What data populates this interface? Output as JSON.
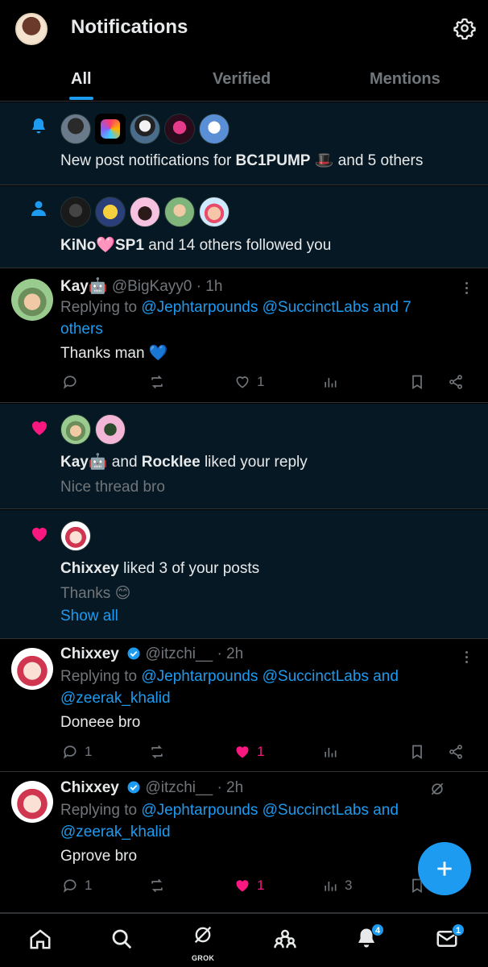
{
  "header": {
    "title": "Notifications",
    "avatar": "profile-avatar",
    "settings_icon": "gear-icon"
  },
  "tabs": [
    {
      "label": "All",
      "active": true
    },
    {
      "label": "Verified"
    },
    {
      "label": "Mentions"
    }
  ],
  "notifications": [
    {
      "type": "new-post",
      "icon": "bell-icon",
      "text_prefix": "New post notifications for ",
      "text_bold": "BC1PUMP",
      "emoji": "🎩",
      "text_suffix": " and 5 others"
    },
    {
      "type": "follow",
      "icon": "person-icon",
      "name": "KiNo",
      "emoji": "🩷",
      "name2": "SP1",
      "text_suffix": " and 14 others followed you"
    },
    {
      "type": "reply",
      "author": "Kay",
      "author_emoji": "🤖",
      "handle": "@BigKayy0",
      "time": "· 1h",
      "replying_prefix": "Replying to ",
      "replying_to": "@Jephtarpounds @SuccinctLabs and 7",
      "replying_to_2": "others",
      "body": "Thanks man",
      "body_emoji": "💙",
      "likes": "1"
    },
    {
      "type": "like",
      "icon": "heart-icon",
      "name1": "Kay",
      "name1_emoji": "🤖",
      "joiner": " and ",
      "name2": "Rocklee",
      "text_suffix": " liked your reply",
      "snippet": "Nice thread bro"
    },
    {
      "type": "like-multi",
      "icon": "heart-icon",
      "name": "Chixxey",
      "text_suffix": " liked 3 of your posts",
      "snippet": "Thanks",
      "snippet_emoji": "😊",
      "show_all": "Show all"
    },
    {
      "type": "reply",
      "author": "Chixxey",
      "handle": "@itzchi__",
      "time": "· 2h",
      "replying_prefix": "Replying to ",
      "replying_to": "@Jephtarpounds @SuccinctLabs and",
      "replying_to_2": "@zeerak_khalid",
      "body": "Doneee bro",
      "replies": "1",
      "likes": "1"
    },
    {
      "type": "reply",
      "author": "Chixxey",
      "handle": "@itzchi__",
      "time": "· 2h",
      "replying_prefix": "Replying to ",
      "replying_to": "@Jephtarpounds @SuccinctLabs and",
      "replying_to_2": "@zeerak_khalid",
      "body": "Gprove bro",
      "replies": "1",
      "likes": "1",
      "views": "3"
    }
  ],
  "bottom_nav": {
    "items": [
      "home-icon",
      "search-icon",
      "grok-icon",
      "communities-icon",
      "notifications-bell-icon",
      "messages-icon"
    ],
    "grok_label": "GROK",
    "notif_badge": "4",
    "messages_badge": "1"
  },
  "colors": {
    "accent": "#1d9bf0",
    "like": "#f91880",
    "unread_bg": "#061823",
    "muted": "#71767b"
  }
}
